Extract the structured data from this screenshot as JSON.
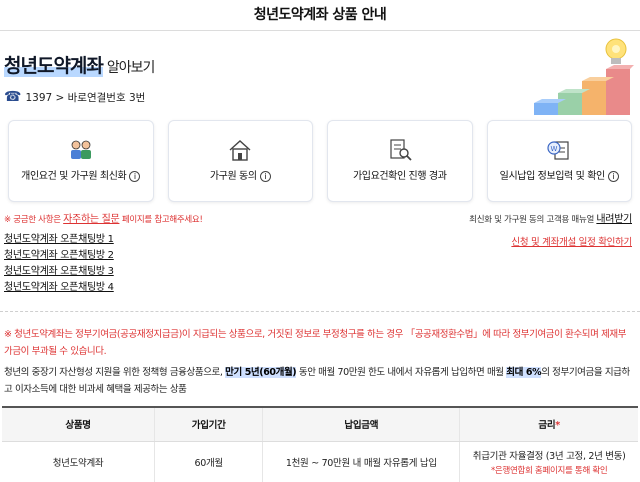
{
  "page": {
    "title": "청년도약계좌 상품 안내"
  },
  "hero": {
    "title": "청년도약계좌",
    "subtitle": "알아보기",
    "phone": "1397 > 바로연결번호 3번"
  },
  "cards": [
    {
      "label": "개인요건 및 가구원 최신화",
      "info": "i"
    },
    {
      "label": "가구원 동의",
      "info": "i"
    },
    {
      "label": "가입요건확인 진행 경과",
      "info": ""
    },
    {
      "label": "일시납입 정보입력 및 확인",
      "info": "i"
    }
  ],
  "notice": {
    "prefix": "※ 궁금한 사항은",
    "faq_link": "자주하는 질문",
    "suffix": "페이지를 참고해주세요!",
    "manual_prefix": "최신화 및 가구원 동의 고객용 매뉴얼",
    "manual_link": "내려받기",
    "schedule_link": "신청 및 계좌개설 일정 확인하기"
  },
  "chat_rooms": [
    "청년도약계좌 오픈채팅방 1",
    "청년도약계좌 오픈채팅방 2",
    "청년도약계좌 오픈채팅방 3",
    "청년도약계좌 오픈채팅방 4"
  ],
  "warning": "※ 청년도약계좌는 정부기여금(공공재정지급금)이 지급되는 상품으로, 거짓된 정보로 부정청구를 하는 경우 「공공재정환수법」에 따라 정부기여금이 환수되며 제재부가금이 부과될 수 있습니다.",
  "description": {
    "part1": "청년의 중장기 자산형성 지원을 위한 정책형 금융상품으로,",
    "highlight1": "만기 5년(60개월)",
    "part2": "동안 매월 70만원 한도 내에서 자유롭게 납입하면 매월",
    "highlight2": "최대 6%",
    "part3": "의 정부기여금을 지급하고 이자소득에 대한 비과세 혜택을 제공하는 상품"
  },
  "table": {
    "headers": [
      "상품명",
      "가입기간",
      "납입금액",
      "금리"
    ],
    "required_mark": "*",
    "row": {
      "name": "청년도약계좌",
      "period": "60개월",
      "amount": "1천원 ~ 70만원 내 매월 자유롭게 납입",
      "rate": "취급기관 자율결정 (3년 고정, 2년 변동)",
      "rate_note": "*은행연합회 홈페이지를 통해 확인"
    }
  },
  "colors": {
    "accent_red": "#dd3333",
    "highlight_blue": "#cfe0ff",
    "text_dark": "#222222"
  },
  "icons": [
    "phone-icon",
    "family-icon",
    "house-icon",
    "document-search-icon",
    "coin-document-icon",
    "lightbulb-stairs-icon",
    "info-icon"
  ]
}
